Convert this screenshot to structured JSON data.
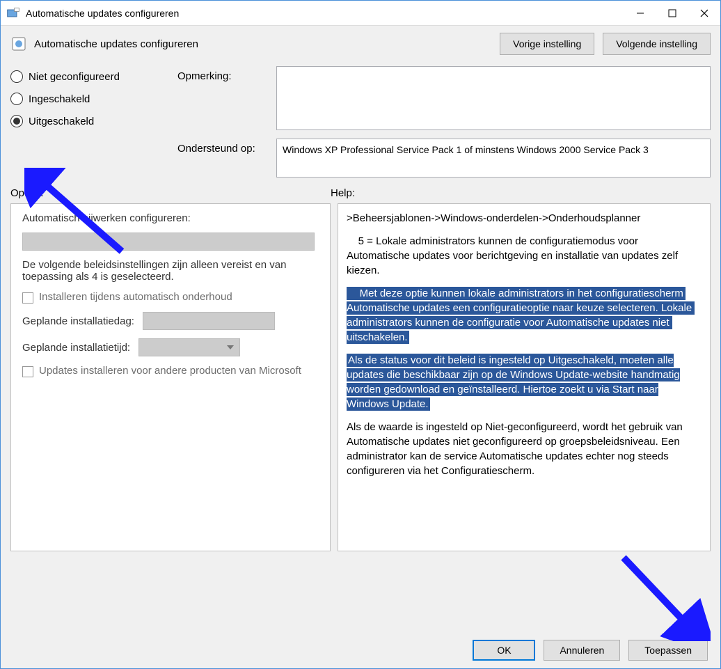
{
  "window": {
    "title": "Automatische updates configureren"
  },
  "header": {
    "title": "Automatische updates configureren",
    "prev_button": "Vorige instelling",
    "next_button": "Volgende instelling"
  },
  "radios": {
    "not_configured": "Niet geconfigureerd",
    "enabled": "Ingeschakeld",
    "disabled": "Uitgeschakeld",
    "selected": "disabled"
  },
  "meta": {
    "comment_label": "Opmerking:",
    "comment_value": "",
    "supported_label": "Ondersteund op:",
    "supported_value": "Windows XP Professional Service Pack 1 of minstens Windows 2000 Service Pack 3"
  },
  "sections": {
    "options_label": "Opties:",
    "help_label": "Help:"
  },
  "options": {
    "configure_label": "Automatisch bijwerken configureren:",
    "required_note": "De volgende beleidsinstellingen zijn alleen vereist en van toepassing als 4 is geselecteerd.",
    "install_during_maintenance": "Installeren tijdens automatisch onderhoud",
    "scheduled_day_label": "Geplande installatiedag:",
    "scheduled_time_label": "Geplande installatietijd:",
    "other_products": "Updates installeren voor andere producten van Microsoft"
  },
  "help": {
    "breadcrumb": ">Beheersjablonen->Windows-onderdelen->Onderhoudsplanner",
    "para5": "    5 = Lokale administrators kunnen de configuratiemodus voor Automatische updates voor berichtgeving en installatie van updates zelf kiezen.",
    "highlight1": "    Met deze optie kunnen lokale administrators in het configuratiescherm Automatische updates een configuratieoptie naar keuze selecteren. Lokale administrators kunnen de configuratie voor Automatische updates niet uitschakelen.",
    "highlight2": "Als de status voor dit beleid is ingesteld op Uitgeschakeld, moeten alle updates die beschikbaar zijn op de Windows Update-website handmatig worden gedownload en geïnstalleerd. Hiertoe zoekt u via Start naar Windows Update.",
    "para_last": "Als de waarde is ingesteld op Niet-geconfigureerd, wordt het gebruik van Automatische updates niet geconfigureerd op groepsbeleidsniveau. Een administrator kan de service Automatische updates echter nog steeds configureren via het Configuratiescherm."
  },
  "footer": {
    "ok": "OK",
    "cancel": "Annuleren",
    "apply": "Toepassen"
  }
}
